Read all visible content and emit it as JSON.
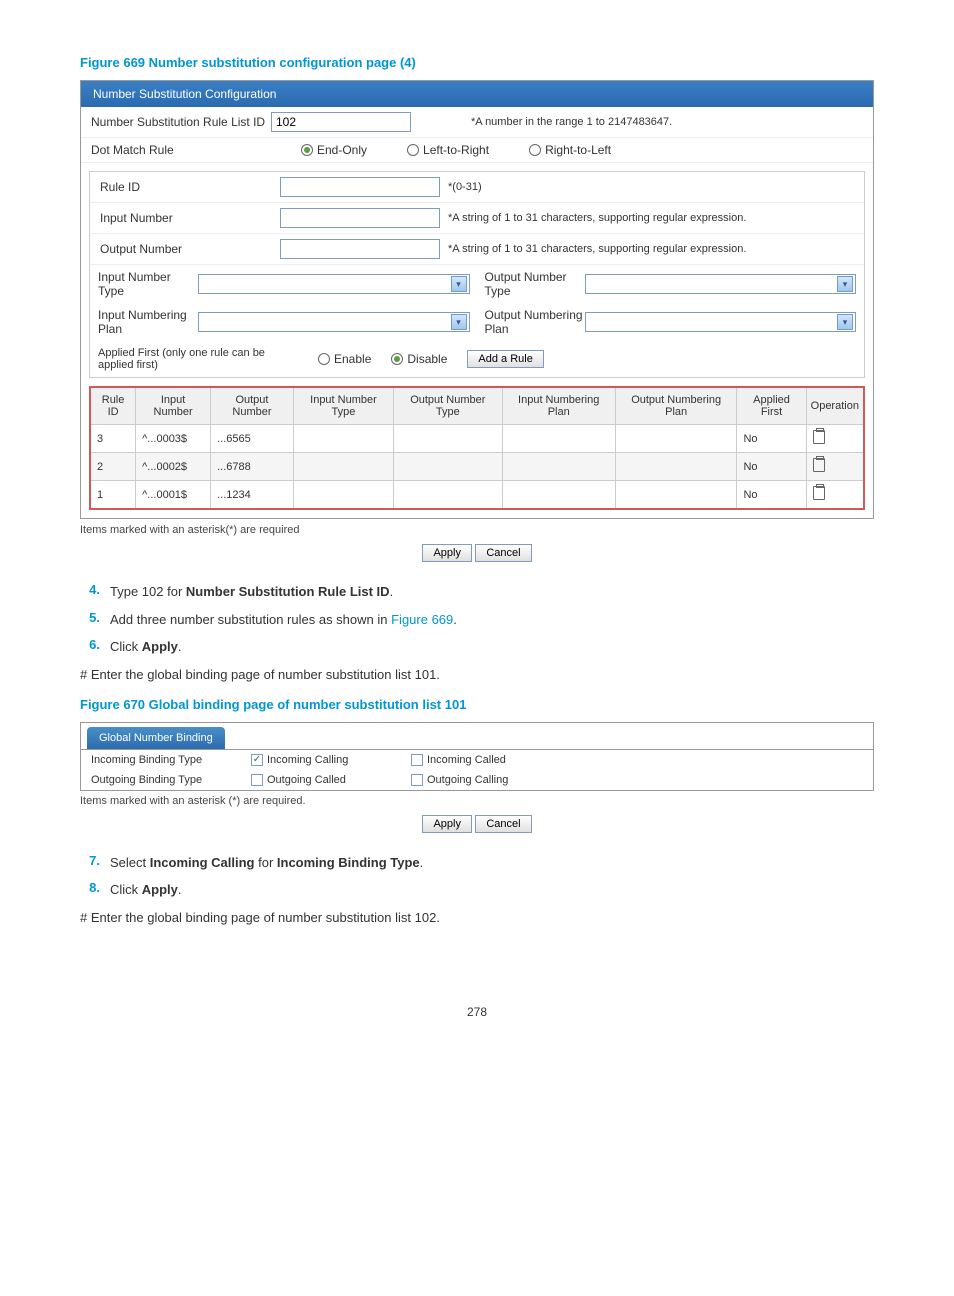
{
  "figure669_title": "Figure 669 Number substitution configuration page (4)",
  "panel1": {
    "header": "Number Substitution Configuration",
    "rule_list_id_label": "Number Substitution Rule List ID",
    "rule_list_id_value": "102",
    "rule_list_id_hint": "*A number in the range 1 to 2147483647.",
    "dot_match_label": "Dot Match Rule",
    "dot_match_options": [
      "End-Only",
      "Left-to-Right",
      "Right-to-Left"
    ],
    "rule_id_label": "Rule ID",
    "rule_id_hint": "*(0-31)",
    "input_number_label": "Input Number",
    "input_number_hint": "*A string of 1 to 31 characters, supporting regular expression.",
    "output_number_label": "Output Number",
    "output_number_hint": "*A string of 1 to 31 characters, supporting regular expression.",
    "input_number_type_label": "Input Number Type",
    "output_number_type_label": "Output Number Type",
    "input_numbering_plan_label": "Input Numbering Plan",
    "output_numbering_plan_label": "Output Numbering Plan",
    "applied_first_label": "Applied First (only one rule can be applied first)",
    "applied_options": [
      "Enable",
      "Disable"
    ],
    "add_rule_btn": "Add a Rule",
    "table_headers": [
      "Rule ID",
      "Input Number",
      "Output Number",
      "Input Number Type",
      "Output Number Type",
      "Input Numbering Plan",
      "Output Numbering Plan",
      "Applied First",
      "Operation"
    ],
    "rows": [
      {
        "id": "3",
        "input": "^...0003$",
        "output": "...6565",
        "applied": "No"
      },
      {
        "id": "2",
        "input": "^...0002$",
        "output": "...6788",
        "applied": "No"
      },
      {
        "id": "1",
        "input": "^...0001$",
        "output": "...1234",
        "applied": "No"
      }
    ]
  },
  "footnote1": "Items marked with an asterisk(*) are required",
  "apply_btn": "Apply",
  "cancel_btn": "Cancel",
  "steps_a": [
    {
      "n": "4.",
      "pre": "Type 102 for ",
      "bold": "Number Substitution Rule List ID",
      "post": "."
    },
    {
      "n": "5.",
      "pre": "Add three number substitution rules as shown in ",
      "link": "Figure 669",
      "post": "."
    },
    {
      "n": "6.",
      "pre": "Click ",
      "bold": "Apply",
      "post": "."
    }
  ],
  "body1": "# Enter the global binding page of number substitution list 101.",
  "figure670_title": "Figure 670 Global binding page of number substitution list 101",
  "panel2": {
    "tab": "Global Number Binding",
    "incoming_label": "Incoming Binding Type",
    "incoming_opts": [
      "Incoming Calling",
      "Incoming Called"
    ],
    "outgoing_label": "Outgoing Binding Type",
    "outgoing_opts": [
      "Outgoing Called",
      "Outgoing Calling"
    ]
  },
  "footnote2": "Items marked with an asterisk (*) are required.",
  "steps_b": [
    {
      "n": "7.",
      "pre": "Select ",
      "bold": "Incoming Calling",
      "mid": " for ",
      "bold2": "Incoming Binding Type",
      "post": "."
    },
    {
      "n": "8.",
      "pre": "Click ",
      "bold": "Apply",
      "post": "."
    }
  ],
  "body2": "# Enter the global binding page of number substitution list 102.",
  "page_number": "278"
}
